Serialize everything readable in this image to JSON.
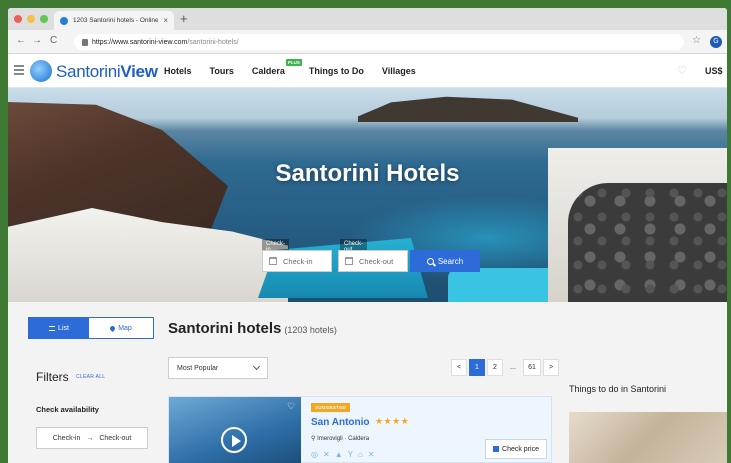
{
  "browser": {
    "tab_title": "1203 Santorini hotels - Online",
    "tab_close": "×",
    "new_tab": "+",
    "back": "←",
    "forward": "→",
    "reload": "C",
    "url_main": "https://www.santorini-view.com",
    "url_path": "/santorini-hotels/",
    "bookmark": "☆",
    "profile_initial": "G"
  },
  "site": {
    "logo_prefix": "Santorini",
    "logo_suffix": "View",
    "nav": [
      "Hotels",
      "Tours",
      "Caldera",
      "Things to Do",
      "Villages"
    ],
    "nav_badge": "PLUS",
    "currency": "US$"
  },
  "hero": {
    "title": "Santorini Hotels",
    "checkin_label": "Check-in",
    "checkout_label": "Check-out",
    "checkin_placeholder": "Check-in",
    "checkout_placeholder": "Check-out",
    "search_label": "Search"
  },
  "sidebar": {
    "view_list": "List",
    "view_map": "Map",
    "filters_title": "Filters",
    "clear_all": "CLEAR ALL",
    "check_availability": "Check availability",
    "checkin": "Check-in",
    "arrow": "→",
    "checkout": "Check-out"
  },
  "results": {
    "title": "Santorini hotels",
    "count": "(1203 hotels)",
    "sort": "Most Popular",
    "pages": [
      "<",
      "1",
      "2",
      "...",
      "61",
      ">"
    ],
    "active_page": "1"
  },
  "hotel": {
    "badge": "SUGGESTED",
    "name": "San Antonio",
    "stars": "★★★★",
    "location": "Imerovigli · Caldera",
    "check_price": "Check price",
    "amenities": [
      "◎",
      "✕",
      "▲",
      "Y",
      "⌂",
      "✕"
    ]
  },
  "things": {
    "title": "Things to do in Santorini"
  }
}
